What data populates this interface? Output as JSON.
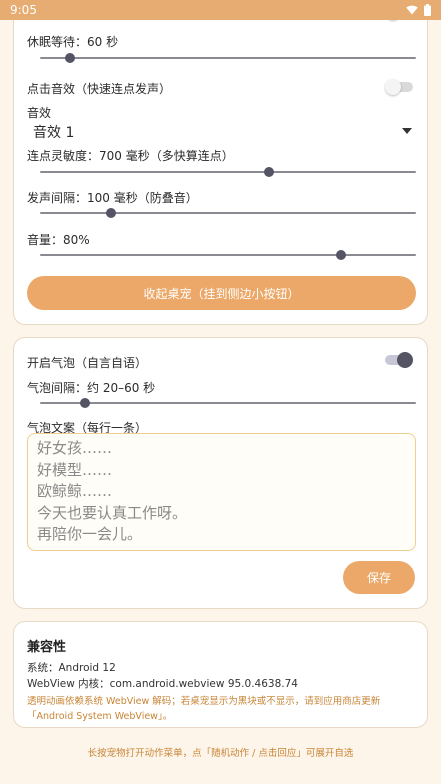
{
  "status_bar": {
    "time": "9:05",
    "wifi_icon": "wifi-icon",
    "battery_icon": "battery-icon"
  },
  "card_sound": {
    "sleep_wait_label": "休眠等待：60 秒",
    "sleep_wait_value": 0.08,
    "click_sound_label": "点击音效（快速连点发声）",
    "click_sound_on": false,
    "sound_label": "音效",
    "sound_selected": "音效 1",
    "sensitivity_label": "连点灵敏度：700 毫秒（多快算连点）",
    "sensitivity_value": 0.61,
    "interval_label": "发声间隔：100 毫秒（防叠音）",
    "interval_value": 0.19,
    "volume_label": "音量：80%",
    "volume_value": 0.8,
    "collapse_button": "收起桌宠（挂到侧边小按钮）"
  },
  "card_bubble": {
    "enable_label": "开启气泡（自言自语）",
    "enable_on": true,
    "interval_label": "气泡间隔：约 20–60 秒",
    "interval_value": 0.12,
    "text_label": "气泡文案（每行一条）",
    "lines": [
      "好女孩……",
      "好模型……",
      "欧鲸鲸……",
      "今天也要认真工作呀。",
      "再陪你一会儿。"
    ],
    "save_button": "保存"
  },
  "card_compat": {
    "title": "兼容性",
    "system_line": "系统：Android 12",
    "webview_line": "WebView 内核：com.android.webview 95.0.4638.74",
    "note": "透明动画依赖系统 WebView 解码；若桌宠显示为黑块或不显示，请到应用商店更新「Android System WebView」。"
  },
  "footer": "长按宠物打开动作菜单，点「随机动作 / 点击回应」可展开自选",
  "colors": {
    "accent": "#eca868",
    "status_bar": "#e6ac72",
    "thumb": "#555465",
    "note": "#c88537"
  }
}
